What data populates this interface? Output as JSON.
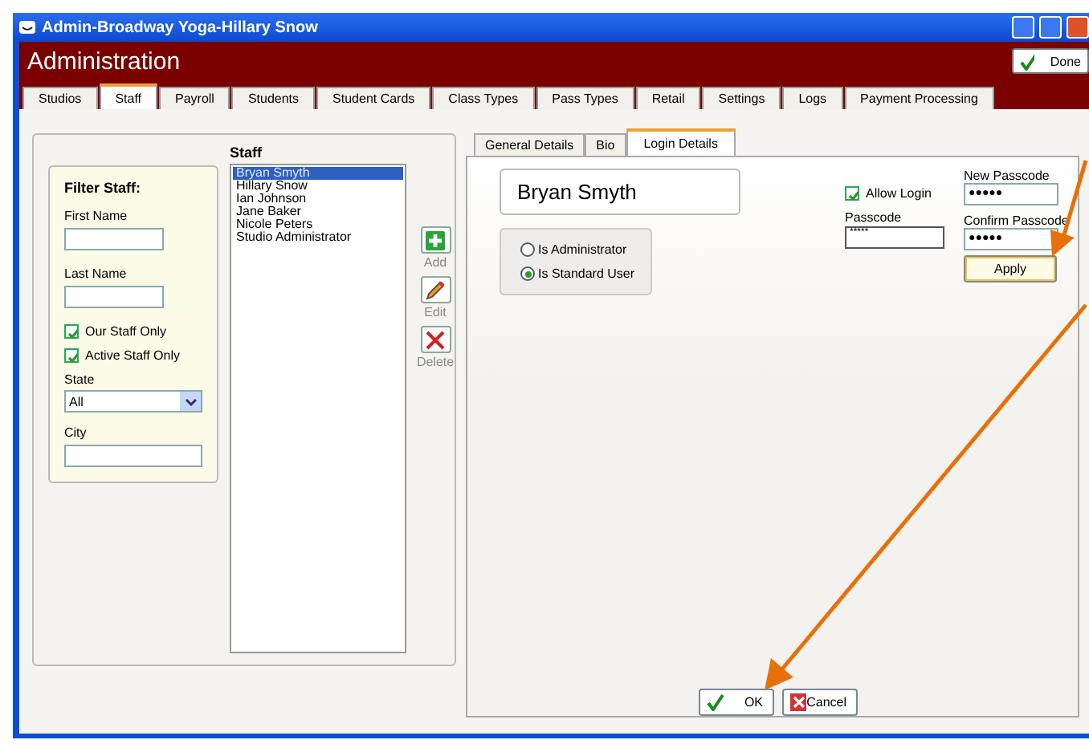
{
  "window": {
    "title": "Admin-Broadway Yoga-Hillary Snow"
  },
  "header": {
    "title": "Administration",
    "done_button": "Done"
  },
  "tabs": [
    {
      "label": "Studios",
      "selected": false
    },
    {
      "label": "Staff",
      "selected": true
    },
    {
      "label": "Payroll",
      "selected": false
    },
    {
      "label": "Students",
      "selected": false
    },
    {
      "label": "Student Cards",
      "selected": false
    },
    {
      "label": "Class Types",
      "selected": false
    },
    {
      "label": "Pass Types",
      "selected": false
    },
    {
      "label": "Retail",
      "selected": false
    },
    {
      "label": "Settings",
      "selected": false
    },
    {
      "label": "Logs",
      "selected": false
    },
    {
      "label": "Payment Processing",
      "selected": false
    }
  ],
  "filter": {
    "title": "Filter Staff:",
    "first_name": {
      "label": "First Name"
    },
    "last_name": {
      "label": "Last Name"
    },
    "checkboxes": [
      {
        "label": "Our Staff Only",
        "checked": true
      },
      {
        "label": "Active Staff Only",
        "checked": true
      }
    ],
    "state": {
      "label": "State",
      "value": "All"
    },
    "city": {
      "label": "City"
    }
  },
  "staff": {
    "title": "Staff",
    "items": [
      {
        "name": "Bryan Smyth",
        "selected": true
      },
      {
        "name": "Hillary Snow",
        "selected": false
      },
      {
        "name": "Ian Johnson",
        "selected": false
      },
      {
        "name": "Jane Baker",
        "selected": false
      },
      {
        "name": "Nicole Peters",
        "selected": false
      },
      {
        "name": "Studio Administrator",
        "selected": false
      }
    ]
  },
  "actions": [
    {
      "kind": "add",
      "label": "Add"
    },
    {
      "kind": "edit",
      "label": "Edit"
    },
    {
      "kind": "delete",
      "label": "Delete"
    }
  ],
  "detail_tabs": [
    {
      "label": "General Details",
      "selected": false
    },
    {
      "label": "Bio",
      "selected": false
    },
    {
      "label": "Login Details",
      "selected": true
    }
  ],
  "login": {
    "name": "Bryan Smyth",
    "roles": [
      {
        "label": "Is Administrator",
        "selected": false
      },
      {
        "label": "Is Standard User",
        "selected": true
      }
    ],
    "allow_login": {
      "label": "Allow Login",
      "checked": true
    },
    "passcode": {
      "label": "Passcode",
      "value": "*****"
    },
    "new_passcode": {
      "label": "New Passcode",
      "value": "●●●●●"
    },
    "confirm_passcode": {
      "label": "Confirm Passcode",
      "value": "●●●●●"
    },
    "apply_button": "Apply"
  },
  "buttons": [
    {
      "kind": "ok",
      "label": "OK"
    },
    {
      "kind": "cancel",
      "label": "Cancel"
    }
  ]
}
